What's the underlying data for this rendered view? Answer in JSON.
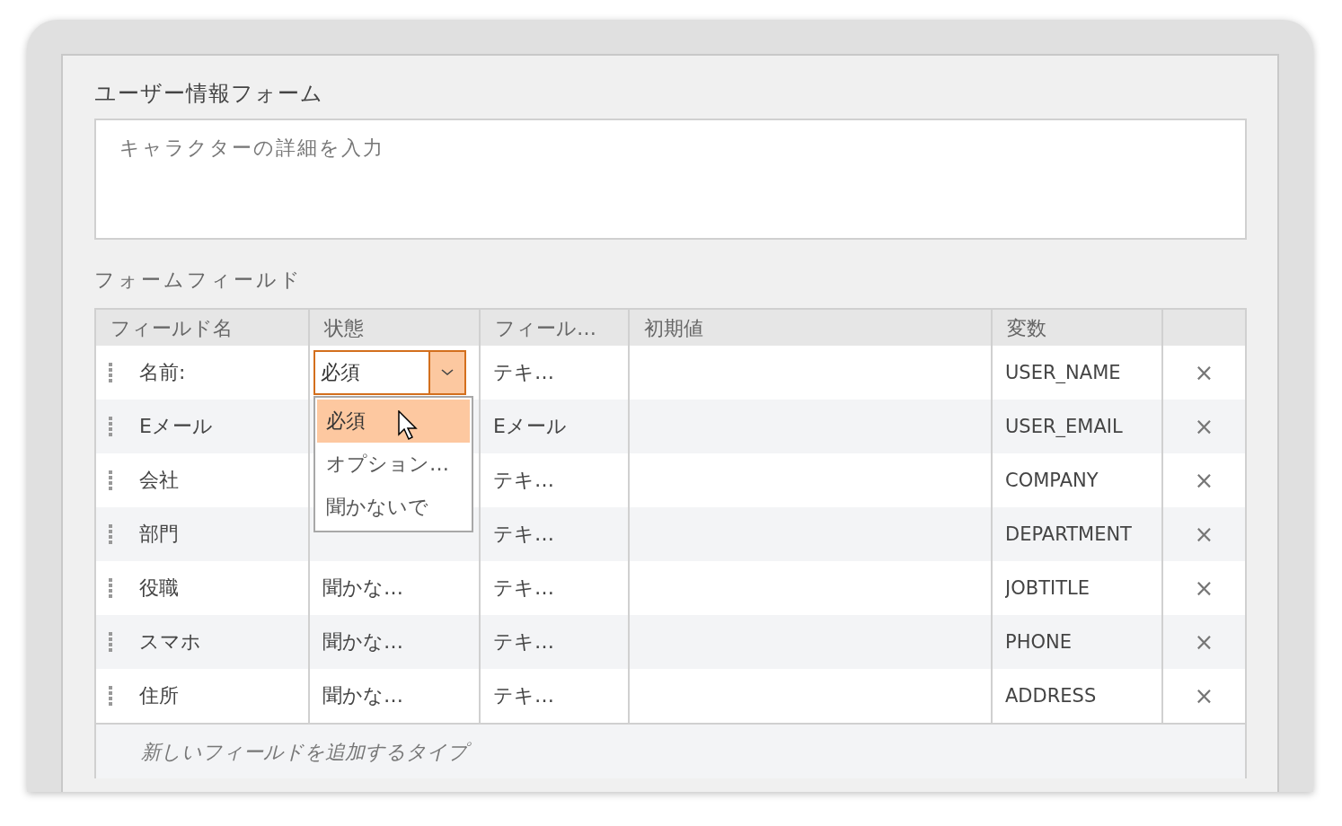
{
  "form": {
    "title": "ユーザー情報フォーム",
    "description": {
      "placeholder": "キャラクターの詳細を入力"
    }
  },
  "fields_section": {
    "label": "フォームフィールド",
    "columns": [
      "フィールド名",
      "状態",
      "フィール…",
      "初期値",
      "変数"
    ],
    "rows": [
      {
        "name": "名前:",
        "status": {
          "kind": "select",
          "value": "必須",
          "open": true,
          "options": [
            {
              "label": "必須",
              "selected": true
            },
            {
              "label": "オプション…",
              "selected": false
            },
            {
              "label": "聞かないで",
              "selected": false
            }
          ]
        },
        "type": "テキ…",
        "variable": "USER_NAME",
        "delete": "×"
      },
      {
        "name": "Eメール",
        "type": "Eメール",
        "variable": "USER_EMAIL",
        "delete": "×"
      },
      {
        "name": "会社",
        "type": "テキ…",
        "variable": "COMPANY",
        "delete": "×"
      },
      {
        "name": "部門",
        "type": "テキ…",
        "variable": "DEPARTMENT",
        "delete": "×"
      },
      {
        "name": "役職",
        "status": {
          "kind": "text",
          "value": "聞かな…"
        },
        "type": "テキ…",
        "variable": "JOBTITLE",
        "delete": "×"
      },
      {
        "name": "スマホ",
        "status": {
          "kind": "text",
          "value": "聞かな…"
        },
        "type": "テキ…",
        "variable": "PHONE",
        "delete": "×"
      },
      {
        "name": "住所",
        "status": {
          "kind": "text",
          "value": "聞かな…"
        },
        "type": "テキ…",
        "variable": "ADDRESS",
        "delete": "×"
      }
    ],
    "new_field": {
      "placeholder": "新しいフィールドを追加するタイプ"
    }
  }
}
